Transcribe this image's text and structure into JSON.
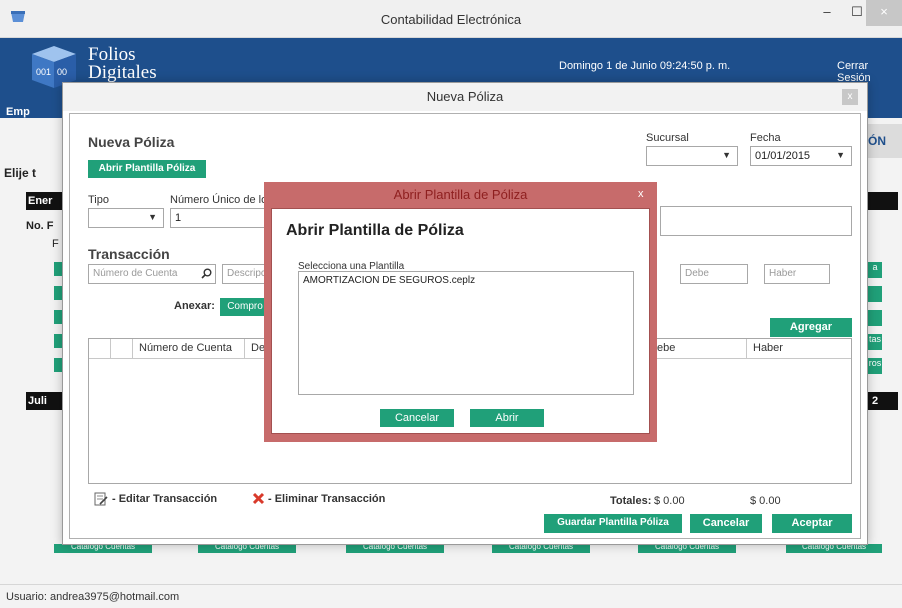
{
  "window": {
    "title": "Contabilidad Electrónica",
    "minimize": "–",
    "maximize": "☐",
    "close": "×"
  },
  "header": {
    "logo_line1": "Folios",
    "logo_line2": "Digitales",
    "date_time": "Domingo 1 de Junio 09:24:50 p. m.",
    "logout": "Cerrar Sesión",
    "company_label": "Emp"
  },
  "background": {
    "right_tab": "ÓN",
    "elige_label": "Elije t",
    "enero_label": "Ener",
    "no_label": "No. F",
    "f_label": "F",
    "julio_label": "Juli",
    "julio_right": "2",
    "side_buttons": [
      "a",
      "",
      "",
      "tas",
      "ros"
    ],
    "bottom_buttons": [
      "Catálogo Cuentas",
      "Catálogo Cuentas",
      "Catálogo Cuentas",
      "Catálogo Cuentas",
      "Catálogo Cuentas",
      "Catálogo Cuentas"
    ]
  },
  "nueva_poliza": {
    "dialog_title": "Nueva Póliza",
    "close": "x",
    "heading": "Nueva Póliza",
    "open_template_button": "Abrir Plantilla Póliza",
    "sucursal_label": "Sucursal",
    "fecha_label": "Fecha",
    "fecha_value": "01/01/2015",
    "tipo_label": "Tipo",
    "numero_unico_label": "Número Único de lo",
    "numero_unico_value": "1",
    "transaccion_heading": "Transacción",
    "cuenta_placeholder": "Número de Cuenta",
    "descripcion_placeholder": "Descripci",
    "debe_placeholder": "Debe",
    "haber_placeholder": "Haber",
    "anexar_label": "Anexar:",
    "comprobante_button": "Compro",
    "agregar_button": "Agregar",
    "grid_columns": [
      "Número de Cuenta",
      "Des",
      "ebe",
      "Haber"
    ],
    "edit_legend": "- Editar Transacción",
    "delete_legend": "- Eliminar Transacción",
    "totales_label": "Totales:",
    "total_debe": "$ 0.00",
    "total_haber": "$ 0.00",
    "save_template_button": "Guardar Plantilla Póliza",
    "cancel_button": "Cancelar",
    "accept_button": "Aceptar"
  },
  "abrir_plantilla": {
    "dialog_title": "Abrir Plantilla de Póliza",
    "close": "x",
    "heading": "Abrir Plantilla de Póliza",
    "select_label": "Selecciona una Plantilla",
    "templates": [
      "AMORTIZACION DE SEGUROS.ceplz"
    ],
    "cancel_button": "Cancelar",
    "open_button": "Abrir"
  },
  "status": {
    "user": "Usuario: andrea3975@hotmail.com"
  },
  "colors": {
    "brand_blue": "#1e4f8c",
    "accent_green": "#20a079",
    "modal_red": "#c76b6b"
  }
}
